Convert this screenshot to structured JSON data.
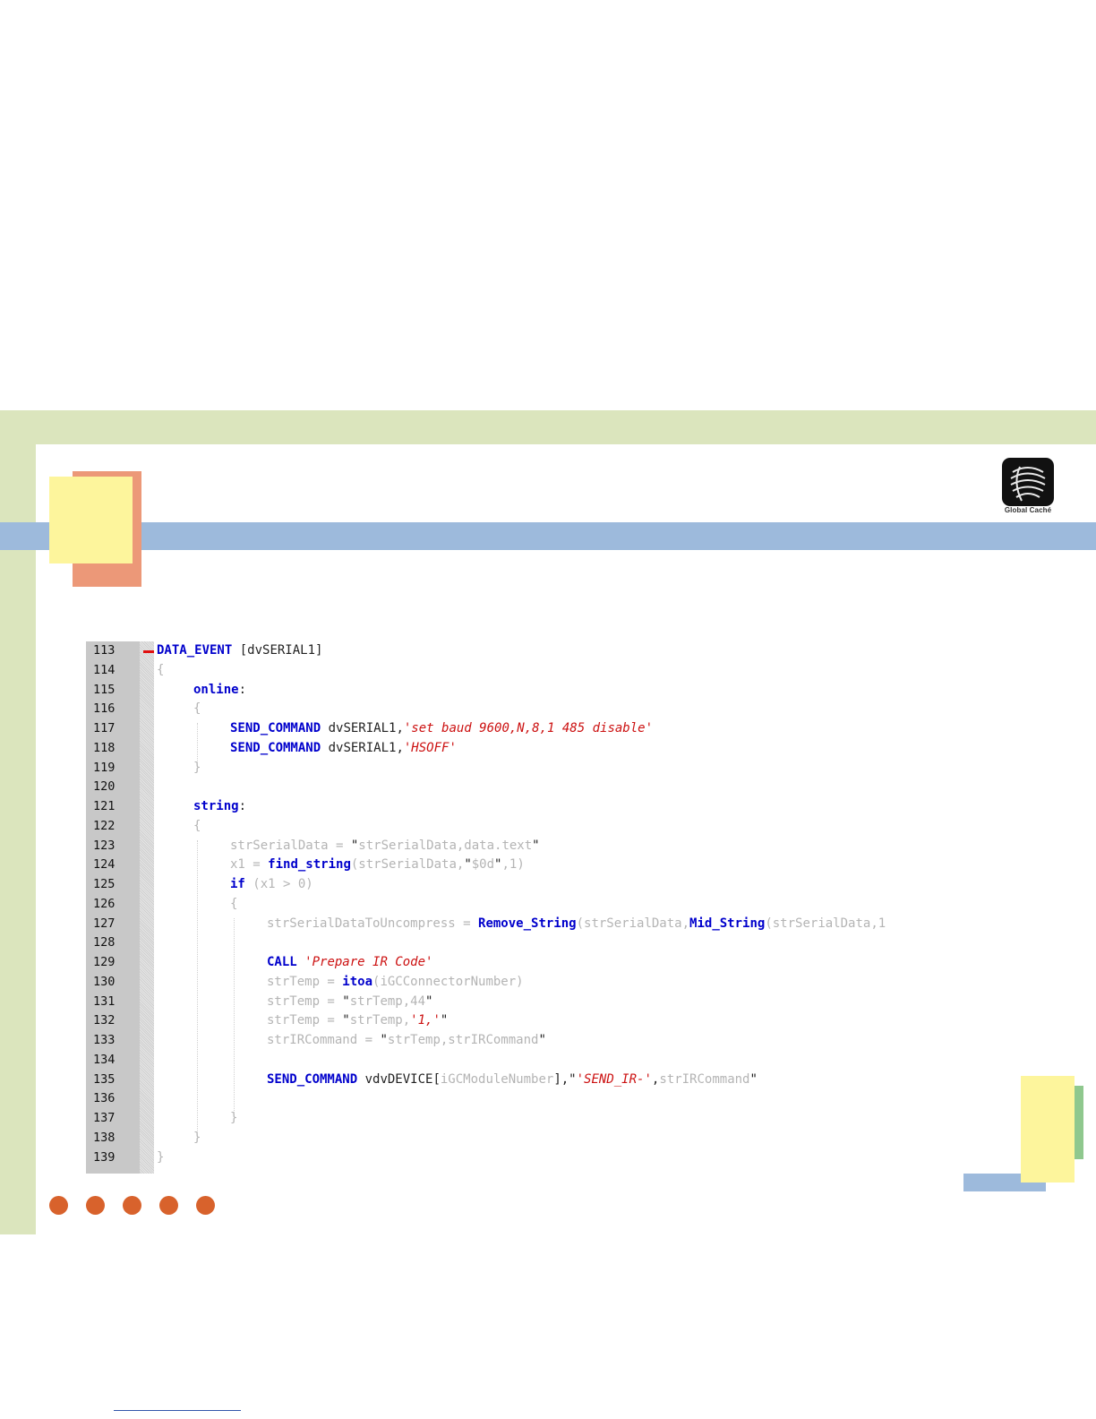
{
  "colors": {
    "band_green": "#dbe5bd",
    "bar_blue": "#9dbadc",
    "square_salmon": "#ec9878",
    "square_yellow": "#fdf59c",
    "accent_green": "#8fc88e",
    "dot_orange": "#d8622c"
  },
  "logo": {
    "icon": "global-cache-logo-icon",
    "caption": "Global Caché"
  },
  "code_editor": {
    "lines": [
      {
        "n": "113",
        "fold": true,
        "indent": 0,
        "tokens": [
          [
            "kw",
            "DATA_EVENT"
          ],
          [
            "pl",
            " [dvSERIAL1]"
          ]
        ]
      },
      {
        "n": "114",
        "indent": 0,
        "tokens": [
          [
            "dim",
            "{"
          ]
        ]
      },
      {
        "n": "115",
        "indent": 1,
        "tokens": [
          [
            "kw",
            "online"
          ],
          [
            "pl",
            ":"
          ]
        ]
      },
      {
        "n": "116",
        "indent": 1,
        "tokens": [
          [
            "dim",
            "{"
          ]
        ]
      },
      {
        "n": "117",
        "indent": 2,
        "tokens": [
          [
            "kw",
            "SEND_COMMAND"
          ],
          [
            "pl",
            " dvSERIAL1,"
          ],
          [
            "str",
            "'set baud 9600,N,8,1 485 disable'"
          ]
        ]
      },
      {
        "n": "118",
        "indent": 2,
        "tokens": [
          [
            "kw",
            "SEND_COMMAND"
          ],
          [
            "pl",
            " dvSERIAL1,"
          ],
          [
            "str",
            "'HSOFF'"
          ]
        ]
      },
      {
        "n": "119",
        "indent": 1,
        "tokens": [
          [
            "dim",
            "}"
          ]
        ]
      },
      {
        "n": "120",
        "indent": 0,
        "tokens": []
      },
      {
        "n": "121",
        "indent": 1,
        "tokens": [
          [
            "kw",
            "string"
          ],
          [
            "pl",
            ":"
          ]
        ]
      },
      {
        "n": "122",
        "indent": 1,
        "tokens": [
          [
            "dim",
            "{"
          ]
        ]
      },
      {
        "n": "123",
        "indent": 2,
        "tokens": [
          [
            "dim",
            "strSerialData = "
          ],
          [
            "pl",
            "\""
          ],
          [
            "dim",
            "strSerialData,data.text"
          ],
          [
            "pl",
            "\""
          ]
        ]
      },
      {
        "n": "124",
        "indent": 2,
        "tokens": [
          [
            "dim",
            "x1 = "
          ],
          [
            "kw",
            "find_string"
          ],
          [
            "dim",
            "(strSerialData,"
          ],
          [
            "pl",
            "\""
          ],
          [
            "dim",
            "$0d"
          ],
          [
            "pl",
            "\""
          ],
          [
            "dim",
            ",1)"
          ]
        ]
      },
      {
        "n": "125",
        "indent": 2,
        "tokens": [
          [
            "kw",
            "if"
          ],
          [
            "dim",
            " (x1 > 0)"
          ]
        ]
      },
      {
        "n": "126",
        "indent": 2,
        "tokens": [
          [
            "dim",
            "{"
          ]
        ]
      },
      {
        "n": "127",
        "indent": 3,
        "tokens": [
          [
            "dim",
            "strSerialDataToUncompress = "
          ],
          [
            "kw",
            "Remove_String"
          ],
          [
            "dim",
            "(strSerialData,"
          ],
          [
            "kw",
            "Mid_String"
          ],
          [
            "dim",
            "(strSerialData,1"
          ]
        ]
      },
      {
        "n": "128",
        "indent": 3,
        "tokens": []
      },
      {
        "n": "129",
        "indent": 3,
        "tokens": [
          [
            "kw",
            "CALL"
          ],
          [
            "pl",
            " "
          ],
          [
            "str",
            "'Prepare IR Code'"
          ]
        ]
      },
      {
        "n": "130",
        "indent": 3,
        "tokens": [
          [
            "dim",
            "strTemp = "
          ],
          [
            "kw",
            "itoa"
          ],
          [
            "dim",
            "(iGCConnectorNumber)"
          ]
        ]
      },
      {
        "n": "131",
        "indent": 3,
        "tokens": [
          [
            "dim",
            "strTemp = "
          ],
          [
            "pl",
            "\""
          ],
          [
            "dim",
            "strTemp,44"
          ],
          [
            "pl",
            "\""
          ]
        ]
      },
      {
        "n": "132",
        "indent": 3,
        "tokens": [
          [
            "dim",
            "strTemp = "
          ],
          [
            "pl",
            "\""
          ],
          [
            "dim",
            "strTemp,"
          ],
          [
            "str",
            "'1,'"
          ],
          [
            "pl",
            "\""
          ]
        ]
      },
      {
        "n": "133",
        "indent": 3,
        "tokens": [
          [
            "dim",
            "strIRCommand = "
          ],
          [
            "pl",
            "\""
          ],
          [
            "dim",
            "strTemp,strIRCommand"
          ],
          [
            "pl",
            "\""
          ]
        ]
      },
      {
        "n": "134",
        "indent": 3,
        "tokens": []
      },
      {
        "n": "135",
        "indent": 3,
        "tokens": [
          [
            "kw",
            "SEND_COMMAND"
          ],
          [
            "pl",
            " vdvDEVICE["
          ],
          [
            "dim",
            "iGCModuleNumber"
          ],
          [
            "pl",
            "],\""
          ],
          [
            "str",
            "'SEND_IR-'"
          ],
          [
            "pl",
            ","
          ],
          [
            "dim",
            "strIRCommand"
          ],
          [
            "pl",
            "\""
          ]
        ]
      },
      {
        "n": "136",
        "indent": 3,
        "tokens": []
      },
      {
        "n": "137",
        "indent": 2,
        "tokens": [
          [
            "dim",
            "}"
          ]
        ]
      },
      {
        "n": "138",
        "indent": 1,
        "tokens": [
          [
            "dim",
            "}"
          ]
        ]
      },
      {
        "n": "139",
        "indent": 0,
        "tokens": [
          [
            "dim",
            "}"
          ]
        ]
      }
    ]
  },
  "pager": {
    "dot_count": 5
  }
}
